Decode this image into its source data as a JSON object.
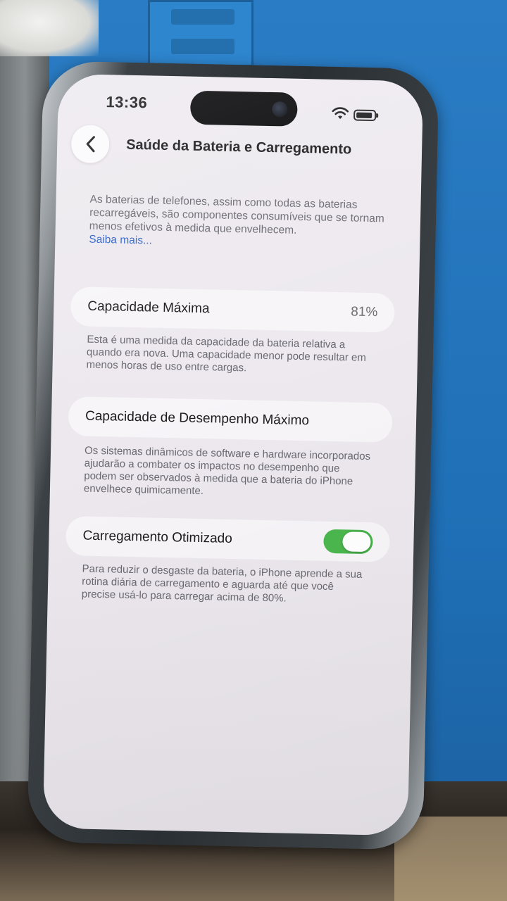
{
  "status_bar": {
    "time": "13:36",
    "icons": [
      "wifi-icon",
      "battery-icon"
    ]
  },
  "nav": {
    "back_icon": "chevron-left-icon",
    "title": "Saúde da Bateria e Carregamento"
  },
  "intro": {
    "text": "As baterias de telefones, assim como todas as baterias recarregáveis, são componentes consumíveis que se tornam menos efetivos à medida que envelhecem.",
    "link": "Saiba mais..."
  },
  "max_capacity": {
    "label": "Capacidade Máxima",
    "value": "81%",
    "footnote": "Esta é uma medida da capacidade da bateria relativa a quando era nova. Uma capacidade menor pode resultar em menos horas de uso entre cargas."
  },
  "peak_performance": {
    "label": "Capacidade de Desempenho Máximo",
    "footnote": "Os sistemas dinâmicos de software e hardware incorporados ajudarão a combater os impactos no desempenho que podem ser observados à medida que a bateria do iPhone envelhece quimicamente."
  },
  "optimized_charging": {
    "label": "Carregamento Otimizado",
    "enabled": true,
    "footnote": "Para reduzir o desgaste da bateria, o iPhone aprende a sua rotina diária de carregamento e aguarda até que você precise usá-lo para carregar acima de 80%."
  },
  "colors": {
    "toggle_on": "#4bb64e",
    "link": "#2d63c8",
    "screen_bg": "#eeeaf0"
  }
}
